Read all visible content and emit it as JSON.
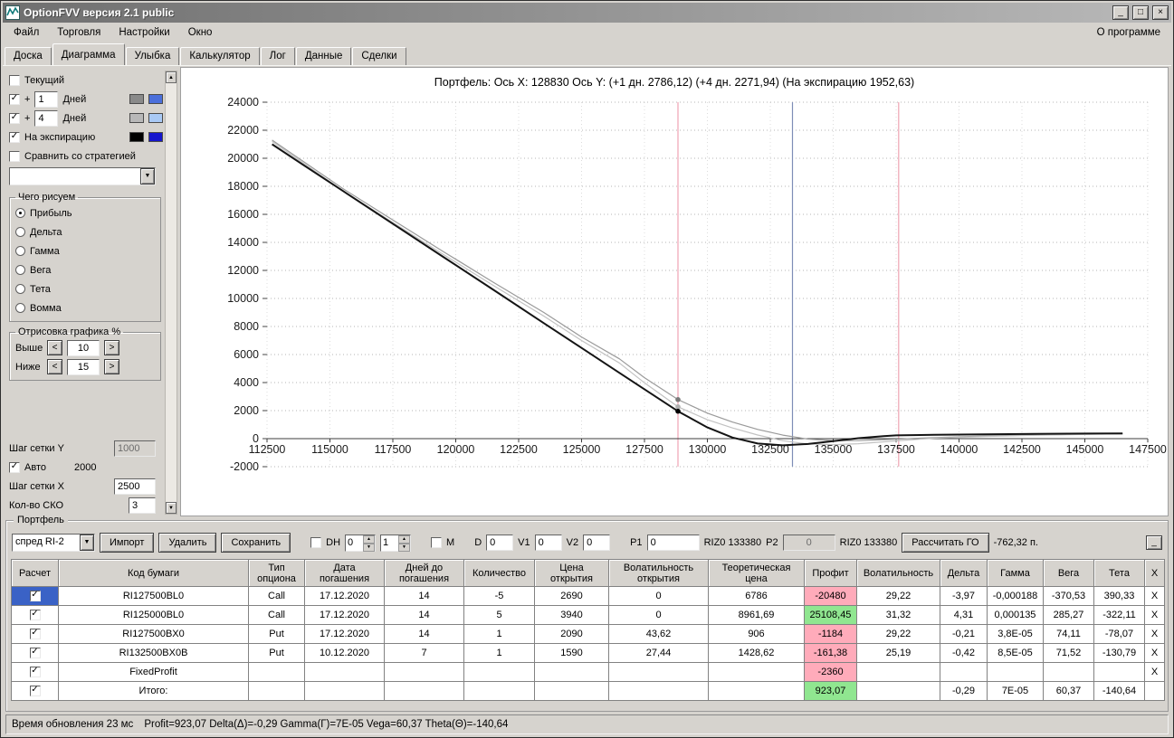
{
  "window": {
    "title": "OptionFVV версия 2.1 public",
    "min": "_",
    "max": "□",
    "close": "×"
  },
  "menu": {
    "items": [
      "Файл",
      "Торговля",
      "Настройки",
      "Окно"
    ],
    "about": "О программе"
  },
  "tabs": [
    "Доска",
    "Диаграмма",
    "Улыбка",
    "Калькулятор",
    "Лог",
    "Данные",
    "Сделки"
  ],
  "sidebar": {
    "current_label": "Текущий",
    "plus_prefix": "+",
    "plus1_value": "1",
    "plus1_label": "Дней",
    "plus1_colors": [
      "#8a8a8a",
      "#4b6fdb"
    ],
    "plus4_value": "4",
    "plus4_label": "Дней",
    "plus4_colors": [
      "#b8b8b8",
      "#a9c9f5"
    ],
    "expiry_label": "На экспирацию",
    "expiry_colors": [
      "#000000",
      "#1515cc"
    ],
    "compare_label": "Сравнить со стратегией",
    "compare_combo_value": "",
    "draw_group": {
      "title": "Чего рисуем",
      "options": [
        "Прибыль",
        "Дельта",
        "Гамма",
        "Вега",
        "Тета",
        "Вомма"
      ],
      "selected": "Прибыль"
    },
    "render_group": {
      "title": "Отрисовка графика %",
      "above_label": "Выше",
      "above_value": "10",
      "below_label": "Ниже",
      "below_value": "15",
      "dec_label": "<",
      "inc_label": ">"
    },
    "grid_y_label": "Шаг сетки Y",
    "grid_y_value": "1000",
    "auto_label": "Авто",
    "auto_value": "2000",
    "grid_x_label": "Шаг сетки X",
    "grid_x_value": "2500",
    "sko_label": "Кол-во СКО",
    "sko_value": "3"
  },
  "chart": {
    "title": "Портфель: Ось X: 128830 Ось Y:  (+1 дн. 2786,12)  (+4 дн. 2271,94)  (На экспирацию 1952,63)"
  },
  "chart_data": {
    "type": "line",
    "title": "Портфель: Ось X: 128830 Ось Y: (+1 дн. 2786,12) (+4 дн. 2271,94) (На экспирацию 1952,63)",
    "x_axis": {
      "min": 112500,
      "max": 147500,
      "step": 2500
    },
    "y_axis": {
      "min": -2000,
      "max": 24000,
      "step": 2000
    },
    "grid": true,
    "vlines": [
      {
        "x": 128830,
        "color": "#efa3b3",
        "label": "cursor-x"
      },
      {
        "x": 133380,
        "color": "#7e8db6",
        "label": "RIZ0 133380"
      },
      {
        "x": 137600,
        "color": "#efa3b3",
        "label": "sko-band"
      }
    ],
    "series": [
      {
        "name": "+1 дн",
        "color": "#9a9a9a",
        "width": 1.2,
        "points": [
          [
            112700,
            21300
          ],
          [
            114000,
            19700
          ],
          [
            115500,
            17850
          ],
          [
            117500,
            15600
          ],
          [
            119500,
            13350
          ],
          [
            121500,
            11150
          ],
          [
            123500,
            9000
          ],
          [
            125000,
            7250
          ],
          [
            126500,
            5700
          ],
          [
            127500,
            4350
          ],
          [
            128830,
            2786
          ],
          [
            130000,
            1820
          ],
          [
            131000,
            1180
          ],
          [
            132000,
            660
          ],
          [
            133000,
            250
          ],
          [
            134000,
            -30
          ],
          [
            135000,
            -140
          ],
          [
            136000,
            -140
          ],
          [
            137500,
            -40
          ],
          [
            139000,
            80
          ],
          [
            141000,
            190
          ],
          [
            143000,
            260
          ],
          [
            145000,
            320
          ],
          [
            146500,
            350
          ]
        ]
      },
      {
        "name": "+4 дн",
        "color": "#c2c2c2",
        "width": 1.2,
        "points": [
          [
            112700,
            21200
          ],
          [
            114000,
            19580
          ],
          [
            115500,
            17700
          ],
          [
            117500,
            15420
          ],
          [
            119500,
            13150
          ],
          [
            121500,
            10920
          ],
          [
            123500,
            8740
          ],
          [
            125000,
            7000
          ],
          [
            126500,
            5400
          ],
          [
            127500,
            3980
          ],
          [
            128830,
            2272
          ],
          [
            130000,
            1350
          ],
          [
            131000,
            760
          ],
          [
            132000,
            260
          ],
          [
            133000,
            -150
          ],
          [
            134000,
            -380
          ],
          [
            135000,
            -430
          ],
          [
            136000,
            -360
          ],
          [
            137500,
            -160
          ],
          [
            139000,
            30
          ],
          [
            141000,
            150
          ],
          [
            143000,
            240
          ],
          [
            145000,
            305
          ],
          [
            146500,
            340
          ]
        ]
      },
      {
        "name": "На экспирацию",
        "color": "#141414",
        "width": 2,
        "points": [
          [
            112700,
            21000
          ],
          [
            114000,
            19460
          ],
          [
            115500,
            17690
          ],
          [
            117500,
            15330
          ],
          [
            119500,
            12970
          ],
          [
            121500,
            10610
          ],
          [
            123500,
            8240
          ],
          [
            125000,
            6470
          ],
          [
            126500,
            4700
          ],
          [
            127500,
            3520
          ],
          [
            128830,
            1953
          ],
          [
            130000,
            800
          ],
          [
            131000,
            80
          ],
          [
            132000,
            -350
          ],
          [
            133000,
            -480
          ],
          [
            134000,
            -380
          ],
          [
            135000,
            -180
          ],
          [
            136000,
            30
          ],
          [
            137000,
            180
          ],
          [
            137500,
            230
          ],
          [
            139000,
            280
          ],
          [
            141000,
            310
          ],
          [
            143000,
            335
          ],
          [
            145000,
            360
          ],
          [
            146500,
            375
          ]
        ]
      }
    ],
    "markers": [
      {
        "x": 128830,
        "y": 2786.12,
        "color": "#7a7a7a"
      },
      {
        "x": 128830,
        "y": 2271.94,
        "color": "#b0b0b0"
      },
      {
        "x": 128830,
        "y": 1952.63,
        "color": "#000000"
      }
    ]
  },
  "portfolio": {
    "group_title": "Портфель",
    "strategy_value": "спред RI-2",
    "import_label": "Импорт",
    "delete_label": "Удалить",
    "save_label": "Сохранить",
    "dh_label": "DH",
    "spin1_value": "0",
    "spin2_value": "1",
    "m_label": "М",
    "d_label": "D",
    "d_value": "0",
    "v1_label": "V1",
    "v1_value": "0",
    "v2_label": "V2",
    "v2_value": "0",
    "p1_label": "P1",
    "p1_value": "0",
    "riz0_1": "RIZ0 133380",
    "p2_label": "P2",
    "p2_value": "0",
    "riz0_2": "RIZ0 133380",
    "calc_go_label": "Рассчитать ГО",
    "go_value": "-762,32 п.",
    "corner_button": "_"
  },
  "table": {
    "headers": [
      [
        "Расчет"
      ],
      [
        "Код бумаги"
      ],
      [
        "Тип",
        "опциона"
      ],
      [
        "Дата",
        "погашения"
      ],
      [
        "Дней до",
        "погашения"
      ],
      [
        "Количество"
      ],
      [
        "Цена",
        "открытия"
      ],
      [
        "Волатильность",
        "открытия"
      ],
      [
        "Теоретическая",
        "цена"
      ],
      [
        "Профит"
      ],
      [
        "Волатильность"
      ],
      [
        "Дельта"
      ],
      [
        "Гамма"
      ],
      [
        "Вега"
      ],
      [
        "Тета"
      ],
      [
        "X"
      ]
    ],
    "rows": [
      {
        "checked": true,
        "selected": true,
        "code": "RI127500BL0",
        "type": "Call",
        "date": "17.12.2020",
        "days": "14",
        "qty": "-5",
        "open_price": "2690",
        "open_vol": "0",
        "theor": "6786",
        "profit": "-20480",
        "profit_state": "neg",
        "vol": "29,22",
        "delta": "-3,97",
        "gamma": "-0,000188",
        "vega": "-370,53",
        "theta": "390,33",
        "x": "X"
      },
      {
        "checked": true,
        "code": "RI125000BL0",
        "type": "Call",
        "date": "17.12.2020",
        "days": "14",
        "qty": "5",
        "open_price": "3940",
        "open_vol": "0",
        "theor": "8961,69",
        "profit": "25108,45",
        "profit_state": "pos",
        "vol": "31,32",
        "delta": "4,31",
        "gamma": "0,000135",
        "vega": "285,27",
        "theta": "-322,11",
        "x": "X"
      },
      {
        "checked": true,
        "code": "RI127500BX0",
        "type": "Put",
        "date": "17.12.2020",
        "days": "14",
        "qty": "1",
        "open_price": "2090",
        "open_vol": "43,62",
        "theor": "906",
        "profit": "-1184",
        "profit_state": "neg",
        "vol": "29,22",
        "delta": "-0,21",
        "gamma": "3,8E-05",
        "vega": "74,11",
        "theta": "-78,07",
        "x": "X"
      },
      {
        "checked": true,
        "code": "RI132500BX0B",
        "type": "Put",
        "date": "10.12.2020",
        "days": "7",
        "qty": "1",
        "open_price": "1590",
        "open_vol": "27,44",
        "theor": "1428,62",
        "profit": "-161,38",
        "profit_state": "neg",
        "vol": "25,19",
        "delta": "-0,42",
        "gamma": "8,5E-05",
        "vega": "71,52",
        "theta": "-130,79",
        "x": "X"
      },
      {
        "checked": true,
        "code": "FixedProfit",
        "profit": "-2360",
        "profit_state": "neg",
        "x": "X"
      },
      {
        "checked": true,
        "code": "Итого:",
        "profit": "923,07",
        "profit_state": "pos",
        "delta": "-0,29",
        "gamma": "7E-05",
        "vega": "60,37",
        "theta": "-140,64",
        "x": ""
      }
    ]
  },
  "status": {
    "time": "Время обновления 23 мс",
    "greeks": "Profit=923,07 Delta(Δ)=-0,29 Gamma(Г)=7E-05 Vega=60,37 Theta(Θ)=-140,64"
  },
  "colors": {
    "profit_negative_bg": "#ffabba",
    "profit_positive_bg": "#90e690",
    "selected_cell_bg": "#3a62c6",
    "window_bg": "#d6d3ce"
  }
}
